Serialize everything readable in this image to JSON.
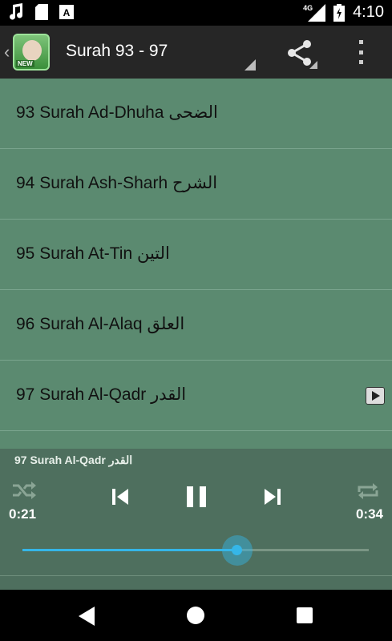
{
  "statusbar": {
    "network": "4G",
    "time": "4:10"
  },
  "appbar": {
    "title": "Surah 93 - 97",
    "icon_badge": "NEW"
  },
  "list": {
    "items": [
      {
        "label": "93 Surah Ad-Dhuha الضحى"
      },
      {
        "label": "94 Surah Ash-Sharh الشرح"
      },
      {
        "label": "95 Surah At-Tin التين"
      },
      {
        "label": "96 Surah Al-Alaq العلق"
      },
      {
        "label": "97 Surah Al-Qadr القدر",
        "playing": true
      }
    ]
  },
  "player": {
    "now_playing": "97 Surah Al-Qadr القدر",
    "elapsed": "0:21",
    "duration": "0:34",
    "progress": 0.62,
    "accent": "#35b6e8"
  }
}
